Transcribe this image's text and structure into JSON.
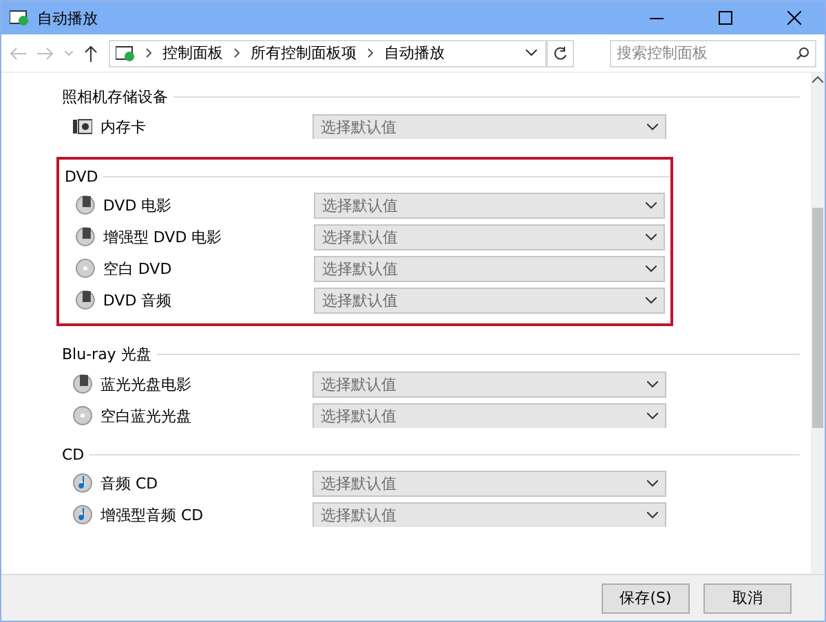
{
  "window": {
    "title": "自动播放"
  },
  "breadcrumb": [
    "控制面板",
    "所有控制面板项",
    "自动播放"
  ],
  "search": {
    "placeholder": "搜索控制面板"
  },
  "sections": [
    {
      "title": "照相机存储设备",
      "highlighted": false,
      "items": [
        {
          "kind": "card",
          "label": "内存卡",
          "value": "选择默认值"
        }
      ]
    },
    {
      "title": "DVD",
      "highlighted": true,
      "items": [
        {
          "kind": "disc",
          "label": "DVD 电影",
          "value": "选择默认值"
        },
        {
          "kind": "disc",
          "label": "增强型 DVD 电影",
          "value": "选择默认值"
        },
        {
          "kind": "blank",
          "label": "空白 DVD",
          "value": "选择默认值"
        },
        {
          "kind": "disc",
          "label": "DVD 音频",
          "value": "选择默认值"
        }
      ]
    },
    {
      "title": "Blu-ray 光盘",
      "highlighted": false,
      "items": [
        {
          "kind": "disc",
          "label": "蓝光光盘电影",
          "value": "选择默认值"
        },
        {
          "kind": "blank",
          "label": "空白蓝光光盘",
          "value": "选择默认值"
        }
      ]
    },
    {
      "title": "CD",
      "highlighted": false,
      "items": [
        {
          "kind": "audio",
          "label": "音频 CD",
          "value": "选择默认值"
        },
        {
          "kind": "audio",
          "label": "增强型音频 CD",
          "value": "选择默认值"
        }
      ]
    }
  ],
  "buttons": [
    "保存(S)",
    "取消"
  ]
}
